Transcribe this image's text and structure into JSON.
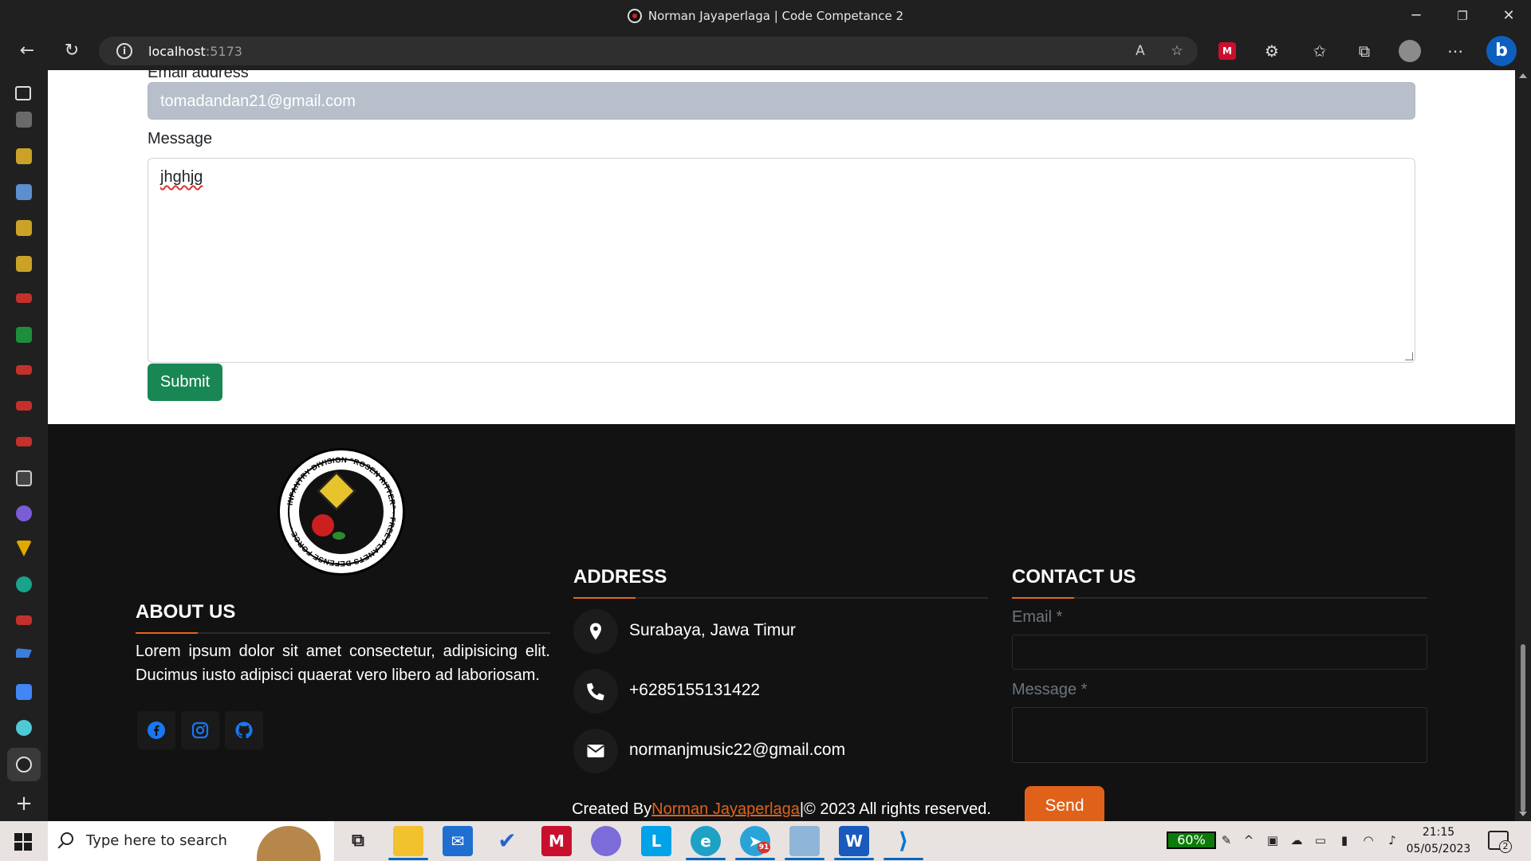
{
  "browser": {
    "window_title": "Norman Jayaperlaga | Code Competance 2",
    "url_host": "localhost",
    "url_port": ":5173"
  },
  "form": {
    "email_label": "Email address",
    "email_value": "tomadandan21@gmail.com",
    "message_label": "Message",
    "message_value": "jhghjg",
    "submit_label": "Submit"
  },
  "footer": {
    "about_heading": "ABOUT US",
    "about_text": "Lorem ipsum dolor sit amet consectetur, adipisicing elit. Ducimus iusto adipisci quaerat vero libero ad laboriosam.",
    "logo_text": "INFANTRY DIVISION \"ROSEN RITTER\" FREE PLANETS DEFENSE FORCE",
    "social": [
      "facebook-icon",
      "instagram-icon",
      "github-icon"
    ],
    "address_heading": "ADDRESS",
    "address_items": [
      {
        "icon": "location-pin-icon",
        "text": "Surabaya, Jawa Timur"
      },
      {
        "icon": "phone-icon",
        "text": "+6285155131422"
      },
      {
        "icon": "envelope-icon",
        "text": "normanjmusic22@gmail.com"
      }
    ],
    "contact_heading": "CONTACT US",
    "contact_email_label": "Email *",
    "contact_message_label": "Message *",
    "send_label": "Send",
    "copyright_prefix": "Created By",
    "copyright_author": "Norman Jayaperlaga",
    "copyright_suffix": "|© 2023 All rights reserved.",
    "accent_color": "#e0611a"
  },
  "taskbar": {
    "search_placeholder": "Type here to search",
    "apps": [
      "task-view-icon",
      "file-explorer-icon",
      "mail-icon",
      "todo-icon",
      "mcafee-icon",
      "copilot-icon",
      "l-app-icon",
      "edge-icon",
      "telegram-icon",
      "photos-icon",
      "word-icon",
      "vscode-icon"
    ],
    "telegram_badge": "91",
    "battery": "60%",
    "time": "21:15",
    "date": "05/05/2023",
    "notifications": "2"
  }
}
